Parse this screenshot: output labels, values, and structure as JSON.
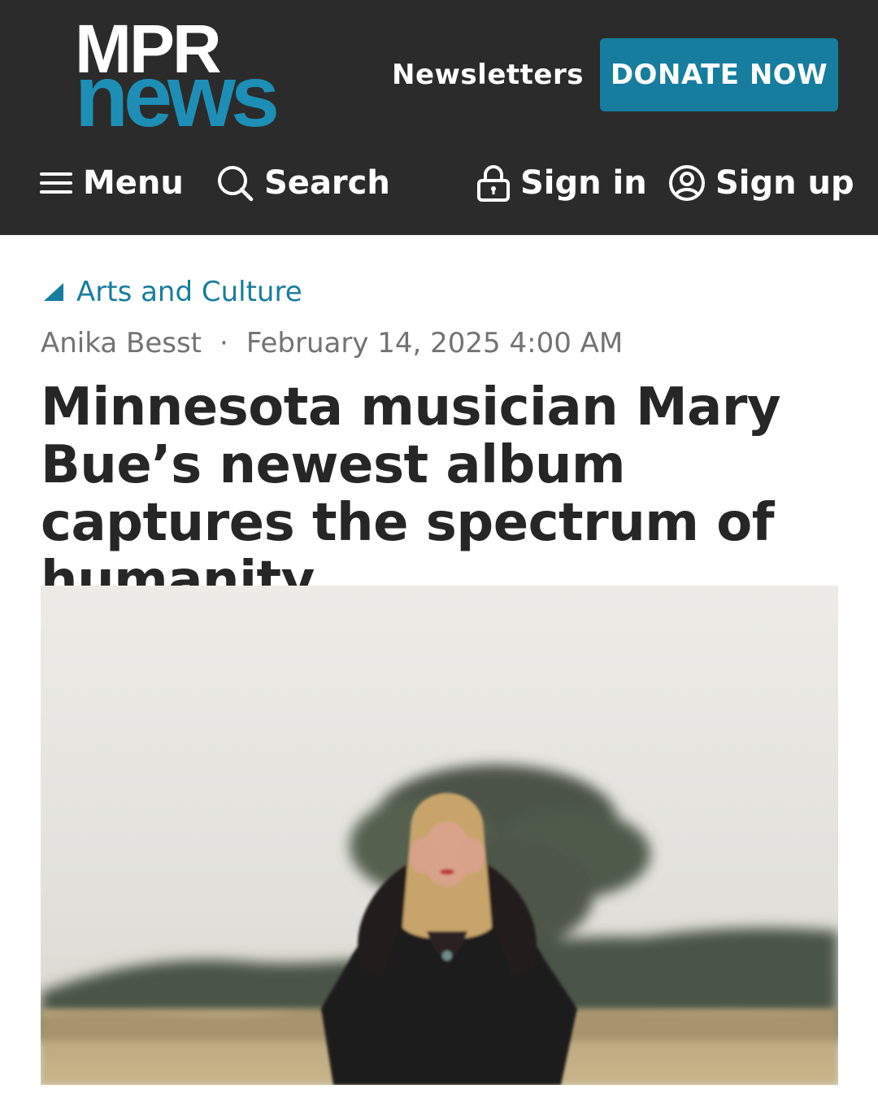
{
  "header": {
    "logo_top": "MPR",
    "logo_bottom": "news",
    "newsletters_label": "Newsletters",
    "donate_label": "DONATE NOW",
    "nav": {
      "menu_label": "Menu",
      "search_label": "Search",
      "signin_label": "Sign in",
      "signup_label": "Sign up"
    }
  },
  "article": {
    "category": "Arts and Culture",
    "author": "Anika Besst",
    "separator": "·",
    "date": "February 14, 2025 4:00 AM",
    "headline": "Minnesota musician Mary Bue’s newest album captures the spectrum of humanity"
  },
  "colors": {
    "header_bg": "#2b2b2b",
    "brand_blue": "#1d8fb6",
    "donate_bg": "#177d9e",
    "category_text": "#177d9e",
    "meta_text": "#737373",
    "headline_text": "#262626"
  },
  "icons": {
    "menu": "hamburger-icon",
    "search": "search-icon",
    "signin": "lock-icon",
    "signup": "user-circle-icon",
    "category": "triangle-icon"
  }
}
